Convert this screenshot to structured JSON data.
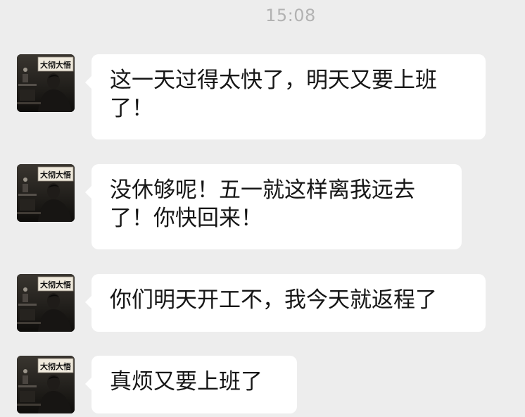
{
  "timestamp": "15:08",
  "contact": {
    "avatar_icon": "avatar-image",
    "avatar_sign_text": "大彻大悟"
  },
  "messages": [
    {
      "text": "这一天过得太快了，明天又要上班了！"
    },
    {
      "text": "没休够呢！五一就这样离我远去了！你快回来！"
    },
    {
      "text": "你们明天开工不，我今天就返程了"
    },
    {
      "text": "真烦又要上班了"
    }
  ],
  "colors": {
    "background": "#ededed",
    "bubble": "#ffffff",
    "timestamp": "#b2b2b2",
    "text": "#161616"
  }
}
